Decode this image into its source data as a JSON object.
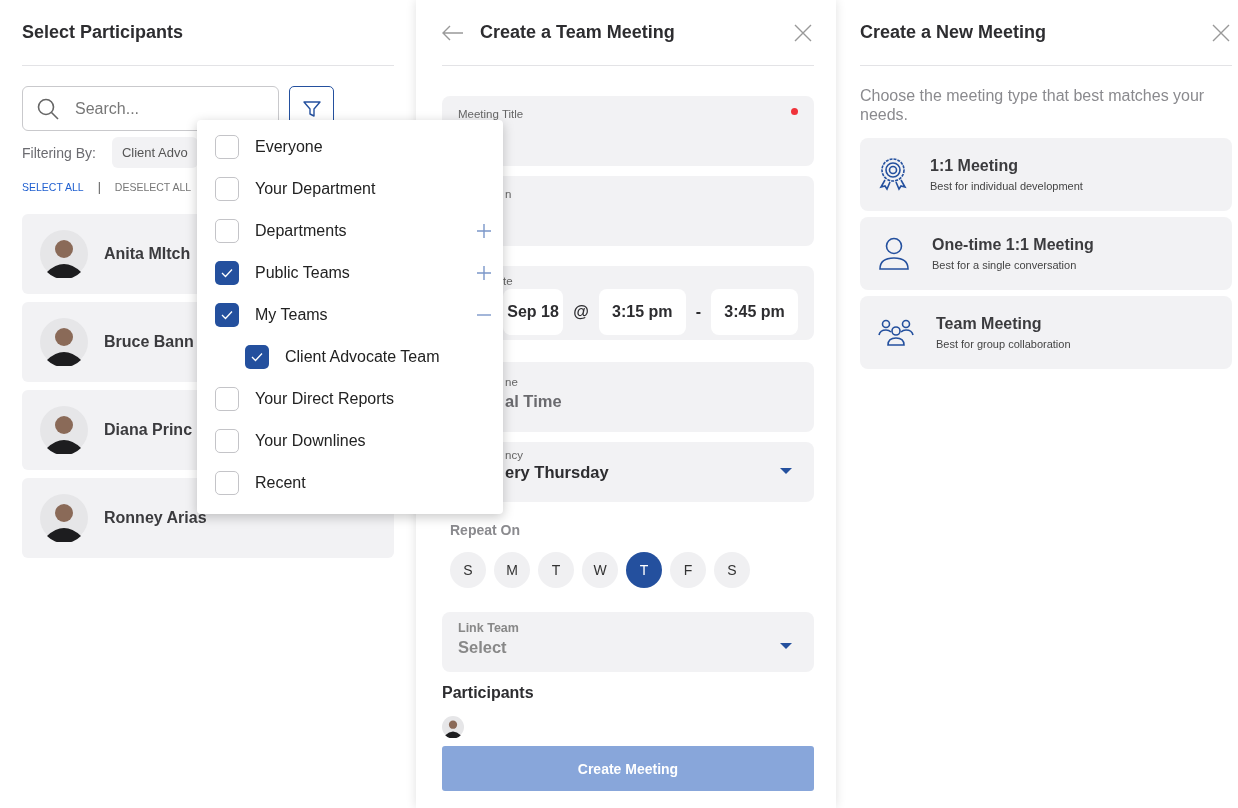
{
  "participants_panel": {
    "title": "Select Participants",
    "search": {
      "placeholder": "Search..."
    },
    "filter_label": "Filtering By:",
    "filter_chip": "Client Advo",
    "select_all": "SELECT ALL",
    "separator": "|",
    "deselect_all": "DESELECT ALL",
    "people": [
      {
        "name": "Anita MItch"
      },
      {
        "name": "Bruce Bann"
      },
      {
        "name": "Diana Princ"
      },
      {
        "name": "Ronney Arias"
      }
    ]
  },
  "filter_menu": {
    "items": [
      {
        "label": "Everyone",
        "checked": false
      },
      {
        "label": "Your Department",
        "checked": false
      },
      {
        "label": "Departments",
        "checked": false,
        "expanded": false
      },
      {
        "label": "Public Teams",
        "checked": true,
        "expanded": false
      },
      {
        "label": "My Teams",
        "checked": true,
        "expanded": true,
        "children": [
          {
            "label": "Client Advocate Team",
            "checked": true
          }
        ]
      },
      {
        "label": "Your Direct Reports",
        "checked": false
      },
      {
        "label": "Your Downlines",
        "checked": false
      },
      {
        "label": "Recent",
        "checked": false
      }
    ]
  },
  "team_meeting": {
    "title": "Create a Team Meeting",
    "fields": [
      {
        "kind": "text",
        "label": "Meeting Title",
        "required": true,
        "covered": false
      },
      {
        "kind": "text",
        "label": "n",
        "covered": true
      },
      {
        "kind": "datetime",
        "label": "te",
        "date": "Sep 18",
        "at": "@",
        "start": "3:15 pm",
        "dash": "-",
        "end": "3:45 pm",
        "covered": true
      },
      {
        "kind": "value",
        "label": "ne",
        "value": "al Time",
        "covered": true
      },
      {
        "kind": "dropdown",
        "label": "ncy",
        "value": "ery Thursday",
        "covered": true
      }
    ],
    "repeat_on": {
      "label": "Repeat On",
      "days": [
        {
          "label": "S",
          "selected": false
        },
        {
          "label": "M",
          "selected": false
        },
        {
          "label": "T",
          "selected": false
        },
        {
          "label": "W",
          "selected": false
        },
        {
          "label": "T",
          "selected": true
        },
        {
          "label": "F",
          "selected": false
        },
        {
          "label": "S",
          "selected": false
        }
      ]
    },
    "link_team": {
      "label": "Link Team",
      "placeholder": "Select"
    },
    "participants_heading": "Participants",
    "create_button": {
      "label": "Create Meeting",
      "disabled": true
    }
  },
  "new_meeting": {
    "title": "Create a New Meeting",
    "subtitle": "Choose the meeting type that best matches your needs.",
    "options": [
      {
        "kind": "award",
        "title": "1:1 Meeting",
        "description": "Best for individual development"
      },
      {
        "kind": "person",
        "title": "One-time 1:1 Meeting",
        "description": "Best for a single conversation"
      },
      {
        "kind": "group",
        "title": "Team Meeting",
        "description": "Best for group collaboration"
      }
    ]
  }
}
